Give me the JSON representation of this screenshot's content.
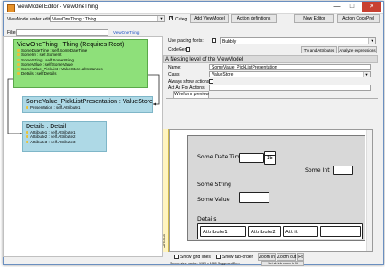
{
  "window": {
    "title": "ViewModel Editor - ViewOneThing",
    "minimize": "—",
    "maximize": "□",
    "close": "✕"
  },
  "toolbar": {
    "under_edit_label": "ViewModel under edit:",
    "under_edit_value": "ViewOneThing : Thing",
    "categ_label": "Categ",
    "add_viewmodel": "Add ViewModel",
    "action_definitions": "Action definitions",
    "new_editor": "New Editor",
    "action_cocoprel": "Action CocoPrel"
  },
  "filter": {
    "label": "Filter",
    "link": "ViewOneThing"
  },
  "diagram": {
    "root": {
      "title": "ViewOneThing : Thing  (Requires Root)",
      "attrs": [
        "SomeDateTime : self.SomeDateTime",
        "SomeInt : self.SomeInt",
        "SomeString : self.SomeString",
        "SomeValue : self.SomeValue",
        "SomeValue_PickList : ValueStore.allInstances",
        "Details : self.Details"
      ],
      "color": "#8ee07a"
    },
    "picklist": {
      "title": "SomeValue_PickListPresentation : ValueStore",
      "attrs": [
        "Presentation : self.Attribute1"
      ],
      "color": "#aed9e6"
    },
    "details": {
      "title": "Details : Detail",
      "attrs": [
        "Attribute1 : self.Attribute1",
        "Attribute2 : self.Attribute2",
        "Attribute3 : self.Attribute3"
      ],
      "color": "#aed9e6"
    }
  },
  "props": {
    "use_placing_fonts_label": "Use placing fonts:",
    "font_value": "Bubbly",
    "codegen_label": "CodeGen:",
    "tv_attributes": "TV and Attributes",
    "analyze": "Analyze expressions",
    "section_title": "A Nesting level of the ViewModel",
    "name_label": "Name:",
    "name_value": "SomeValue_PickListPresentation",
    "class_label": "Class:",
    "class_value": "ValueStore",
    "always_show_label": "Always show actions",
    "act_as_label": "Act As For Actions:",
    "wireform_tab": "Wireform preview",
    "vertical_tab": "ACTIONS"
  },
  "wireframe": {
    "some_date_time": "Some Date Time",
    "calendar_number": "15",
    "some_int": "Some Int",
    "some_string": "Some String",
    "some_value": "Some Value",
    "details": "Details",
    "col1": "Attribute1",
    "col2": "Attribute2",
    "col3": "Attrit"
  },
  "bottom": {
    "show_grid": "Show grid lines",
    "show_tab_order": "Show tab-order",
    "zoom_in": "Zoom in",
    "zoom_out": "Zoom out",
    "fit": "Fit",
    "status": "Screen size marker: 1920 x 1080  SuggestedDom",
    "set_shrink": "Set shrink zoom to fit"
  }
}
